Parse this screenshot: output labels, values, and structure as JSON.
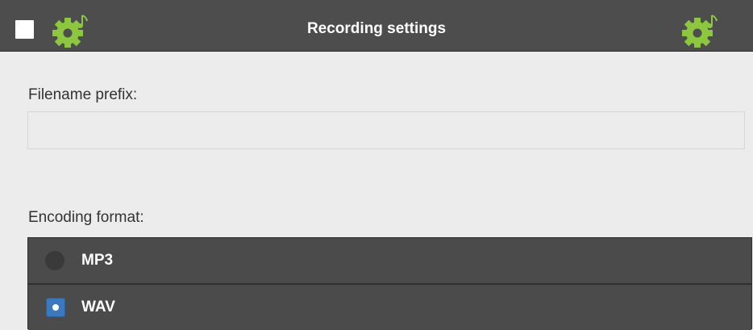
{
  "header": {
    "title": "Recording settings"
  },
  "icons": {
    "left": "gear-music-note-icon",
    "right": "gear-music-note-icon",
    "accent": "#8dc63f"
  },
  "filename": {
    "label": "Filename prefix:",
    "value": "",
    "placeholder": ""
  },
  "encoding": {
    "label": "Encoding format:",
    "options": [
      {
        "label": "MP3",
        "selected": false
      },
      {
        "label": "WAV",
        "selected": true
      }
    ]
  },
  "colors": {
    "header_bg": "#4d4d4d",
    "body_bg": "#ececec",
    "option_bg": "#4b4b4b",
    "selected_radio": "#3a78c0"
  }
}
